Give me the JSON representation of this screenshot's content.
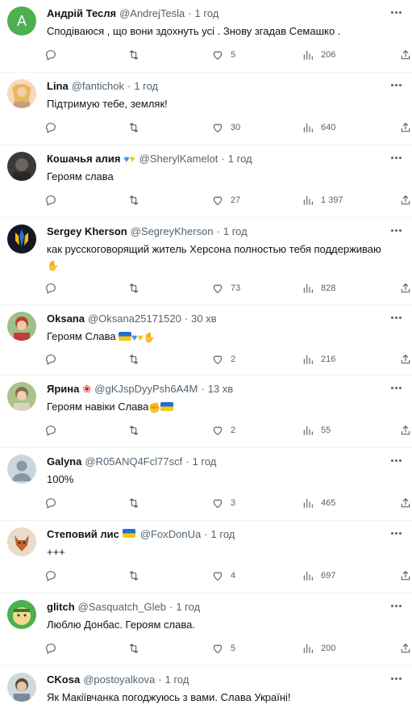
{
  "tweets": [
    {
      "name": "Андрій Тесля",
      "handle": "@AndrejTesla",
      "time": "1 год",
      "text": "Сподіваюся , що вони здохнуть усі . Знову згадав Семашко .",
      "likes": "5",
      "views": "206",
      "avatar_letter": "A",
      "avatar_color": "#4caf50"
    },
    {
      "name": "Lina",
      "handle": "@fantichok",
      "time": "1 год",
      "text": "Підтримую тебе, земляк!",
      "likes": "30",
      "views": "640"
    },
    {
      "name": "Кошачья алия",
      "handle": "@SherylKamelot",
      "time": "1 год",
      "text": "Героям слава",
      "likes": "27",
      "views": "1 397"
    },
    {
      "name": "Sergey Kherson",
      "handle": "@SegreyKherson",
      "time": "1 год",
      "text": "как русскоговорящий житель Херсона полностью тебя поддерживаю",
      "likes": "73",
      "views": "828"
    },
    {
      "name": "Oksana",
      "handle": "@Oksana25171520",
      "time": "30 хв",
      "text": "Героям Слава",
      "likes": "2",
      "views": "216"
    },
    {
      "name": "Ярина",
      "handle": "@gKJspDyyPsh6A4M",
      "time": "13 хв",
      "text": "Героям навіки Слава",
      "likes": "2",
      "views": "55"
    },
    {
      "name": "Galyna",
      "handle": "@R05ANQ4Fcl77scf",
      "time": "1 год",
      "text": "100%",
      "likes": "3",
      "views": "465"
    },
    {
      "name": "Степовий лис",
      "handle": "@FoxDonUa",
      "time": "1 год",
      "text": "+++",
      "likes": "4",
      "views": "697"
    },
    {
      "name": "glitch",
      "handle": "@Sasquatch_Gleb",
      "time": "1 год",
      "text": "Люблю Донбас. Героям слава.",
      "likes": "5",
      "views": "200"
    },
    {
      "name": "CKosa",
      "handle": "@postoyalkova",
      "time": "1 год",
      "text": "Як Макіївчанка погоджуюсь з вами. Слава Україні!"
    }
  ],
  "colors": {
    "text": "#0f1419",
    "secondary": "#536471",
    "divider": "#eff3f4"
  }
}
